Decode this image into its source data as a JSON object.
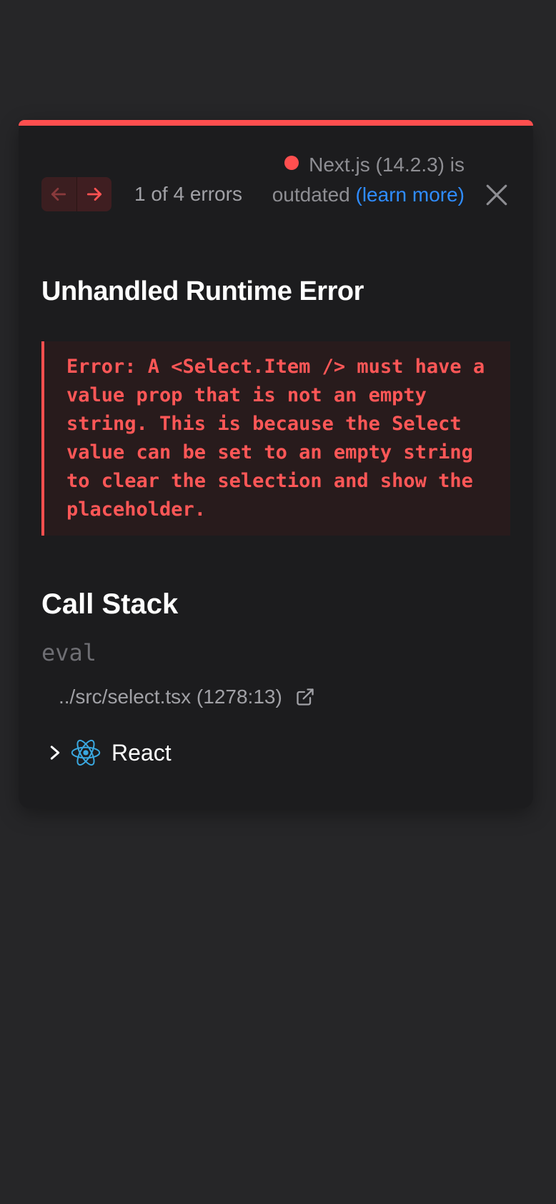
{
  "header": {
    "prev_icon": "arrow-left-icon",
    "next_icon": "arrow-right-icon",
    "error_count": "1 of 4 errors",
    "version_text": "Next.js (14.2.3) is outdated",
    "learn_more": "(learn more)",
    "close_icon": "close-icon",
    "colors": {
      "accent": "#ff4f4f",
      "link": "#2f8cff"
    }
  },
  "error": {
    "title": "Unhandled Runtime Error",
    "message": "Error: A <Select.Item /> must have a value prop that is not an empty string. This is because the Select value can be set to an empty string to clear the selection and show the placeholder."
  },
  "call_stack": {
    "title": "Call Stack",
    "frames": [
      {
        "function": "eval",
        "location": "../src/select.tsx (1278:13)",
        "icon": "external-link-icon"
      }
    ],
    "collapsed_group": {
      "label": "React",
      "icon": "react-icon",
      "toggle_icon": "chevron-right-icon"
    }
  }
}
